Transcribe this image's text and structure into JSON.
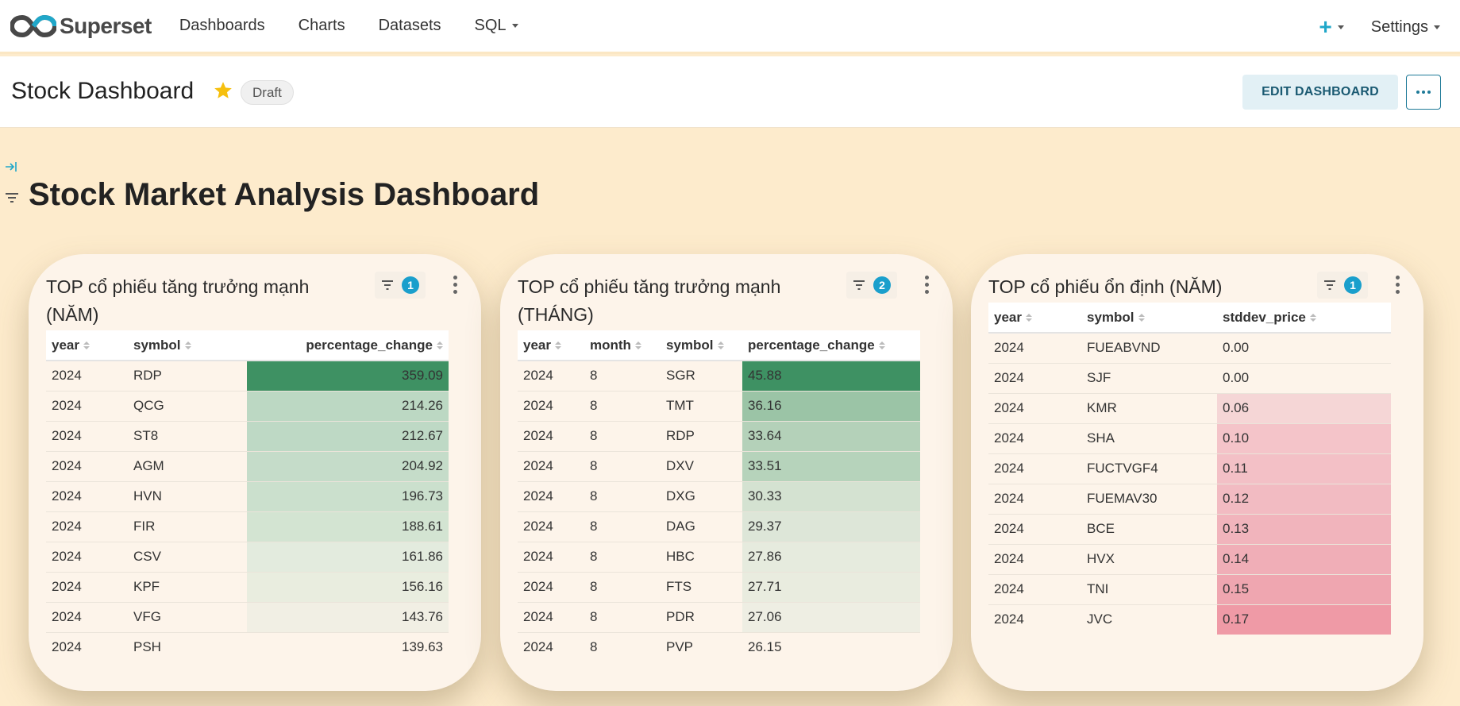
{
  "nav": {
    "brand": "Superset",
    "items": [
      "Dashboards",
      "Charts",
      "Datasets",
      "SQL"
    ],
    "settings": "Settings"
  },
  "header": {
    "title": "Stock Dashboard",
    "status": "Draft",
    "edit_label": "EDIT DASHBOARD"
  },
  "dashboard_title": "Stock Market Analysis Dashboard",
  "colors": {
    "accent": "#20a7c9",
    "green_strong": "#3e9163",
    "red_strong": "#ef9aa6"
  },
  "cards": [
    {
      "title_line1": "TOP cổ phiếu tăng trưởng mạnh",
      "title_line2": "(NĂM)",
      "filter_count": "1",
      "columns": [
        "year",
        "symbol",
        "percentage_change"
      ],
      "rows": [
        [
          "2024",
          "RDP",
          "359.09"
        ],
        [
          "2024",
          "QCG",
          "214.26"
        ],
        [
          "2024",
          "ST8",
          "212.67"
        ],
        [
          "2024",
          "AGM",
          "204.92"
        ],
        [
          "2024",
          "HVN",
          "196.73"
        ],
        [
          "2024",
          "FIR",
          "188.61"
        ],
        [
          "2024",
          "CSV",
          "161.86"
        ],
        [
          "2024",
          "KPF",
          "156.16"
        ],
        [
          "2024",
          "VFG",
          "143.76"
        ],
        [
          "2024",
          "PSH",
          "139.63"
        ]
      ]
    },
    {
      "title_line1": "TOP cổ phiếu tăng trưởng mạnh",
      "title_line2": "(THÁNG)",
      "filter_count": "2",
      "columns": [
        "year",
        "month",
        "symbol",
        "percentage_change"
      ],
      "rows": [
        [
          "2024",
          "8",
          "SGR",
          "45.88"
        ],
        [
          "2024",
          "8",
          "TMT",
          "36.16"
        ],
        [
          "2024",
          "8",
          "RDP",
          "33.64"
        ],
        [
          "2024",
          "8",
          "DXV",
          "33.51"
        ],
        [
          "2024",
          "8",
          "DXG",
          "30.33"
        ],
        [
          "2024",
          "8",
          "DAG",
          "29.37"
        ],
        [
          "2024",
          "8",
          "HBC",
          "27.86"
        ],
        [
          "2024",
          "8",
          "FTS",
          "27.71"
        ],
        [
          "2024",
          "8",
          "PDR",
          "27.06"
        ],
        [
          "2024",
          "8",
          "PVP",
          "26.15"
        ]
      ]
    },
    {
      "title_line1": "TOP cổ phiếu ổn định (NĂM)",
      "title_line2": "",
      "filter_count": "1",
      "columns": [
        "year",
        "symbol",
        "stddev_price"
      ],
      "rows": [
        [
          "2024",
          "FUEABVND",
          "0.00"
        ],
        [
          "2024",
          "SJF",
          "0.00"
        ],
        [
          "2024",
          "KMR",
          "0.06"
        ],
        [
          "2024",
          "SHA",
          "0.10"
        ],
        [
          "2024",
          "FUCTVGF4",
          "0.11"
        ],
        [
          "2024",
          "FUEMAV30",
          "0.12"
        ],
        [
          "2024",
          "BCE",
          "0.13"
        ],
        [
          "2024",
          "HVX",
          "0.14"
        ],
        [
          "2024",
          "TNI",
          "0.15"
        ],
        [
          "2024",
          "JVC",
          "0.17"
        ]
      ]
    }
  ]
}
